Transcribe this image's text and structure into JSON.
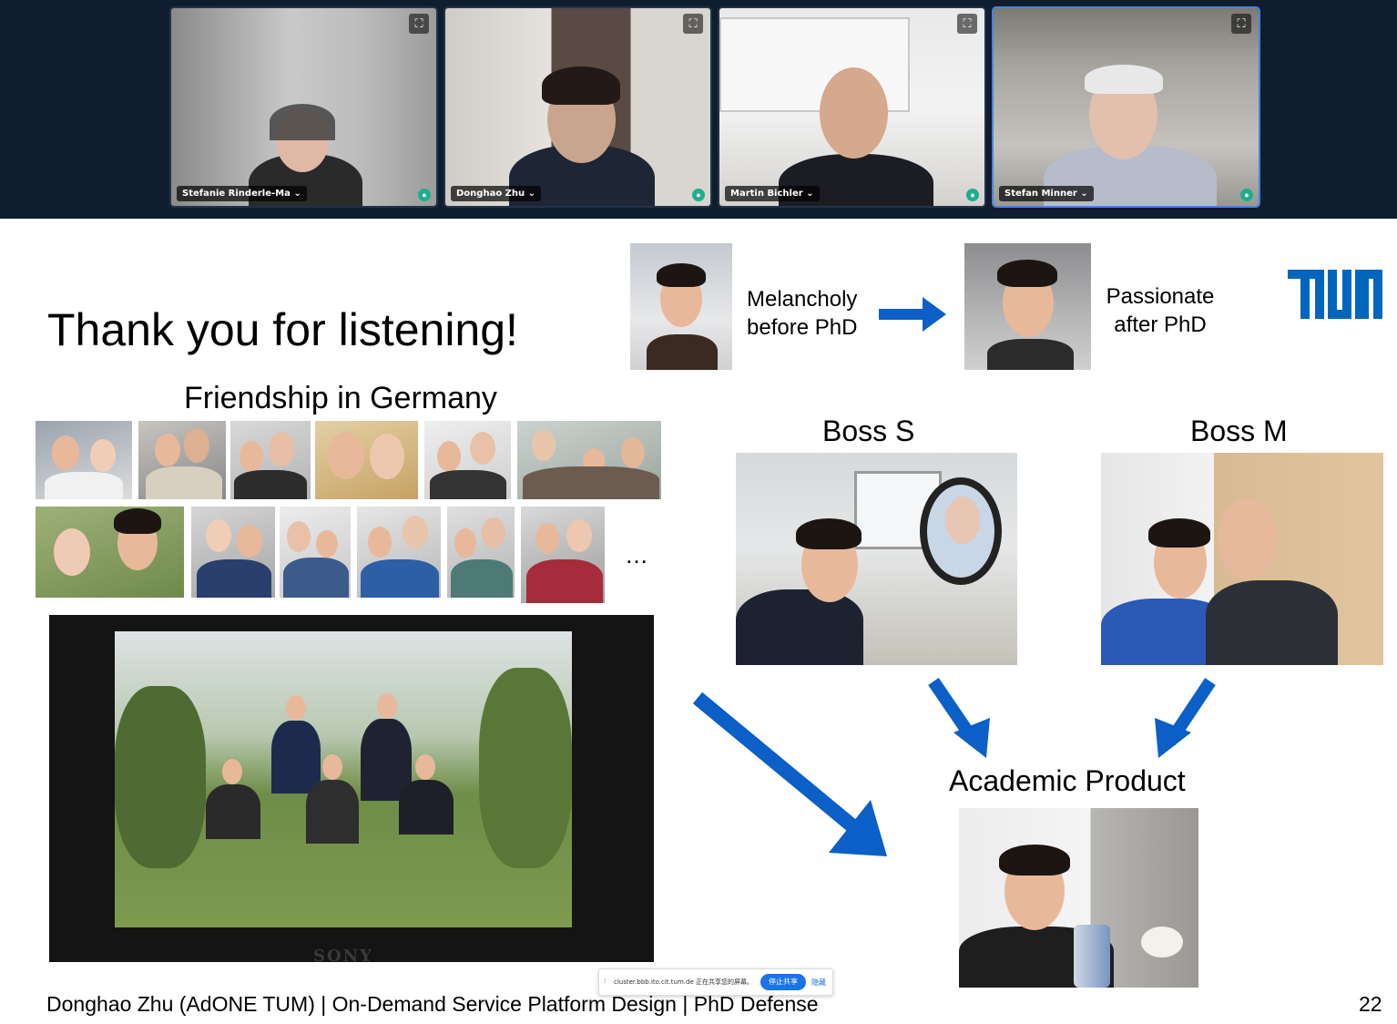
{
  "participants": [
    {
      "name": "Stefanie Rinderle-Ma",
      "expand_icon": "⛶",
      "chevron": "⌄"
    },
    {
      "name": "Donghao Zhu",
      "expand_icon": "⛶",
      "chevron": "⌄"
    },
    {
      "name": "Martin Bichler",
      "expand_icon": "⛶",
      "chevron": "⌄"
    },
    {
      "name": "Stefan Minner",
      "expand_icon": "⛶",
      "chevron": "⌄"
    }
  ],
  "slide": {
    "title": "Thank you for listening!",
    "melancholy_line1": "Melancholy",
    "melancholy_line2": "before PhD",
    "passionate_line1": "Passionate",
    "passionate_line2": "after PhD",
    "friendship_heading": "Friendship in Germany",
    "ellipsis": "…",
    "boss_s": "Boss S",
    "boss_m": "Boss M",
    "academic_product": "Academic Product",
    "camera_brand": "SONY",
    "footer": "Donghao Zhu (AdONE TUM) | On-Demand Service Platform Design | PhD Defense",
    "page_number": "22"
  },
  "share_bar": {
    "message": "cluster.bbb.ito.cit.tum.de 正在共享您的屏幕。",
    "stop_button": "停止共享",
    "hide_button": "隐藏",
    "grip": "⁞"
  },
  "colors": {
    "topbar": "#0f1d2e",
    "active_border": "#3f86e6",
    "arrow_blue": "#0b5fc7",
    "tum_blue": "#0065bd",
    "mic_green": "#1fae8c"
  }
}
